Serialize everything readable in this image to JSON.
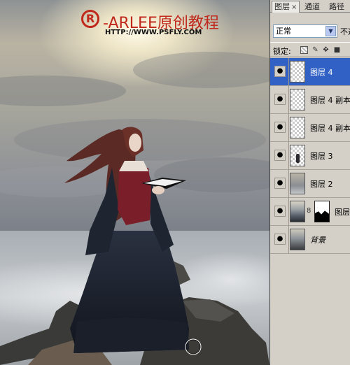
{
  "watermark": {
    "logo_mark": "R",
    "brand": "-ARLEE原创教程",
    "url": "HTTP://WWW.PSFLY.COM"
  },
  "layers_panel": {
    "tabs": [
      {
        "label": "图层",
        "active": true,
        "close": "×"
      },
      {
        "label": "通道",
        "active": false
      },
      {
        "label": "路径",
        "active": false
      }
    ],
    "blend_mode": "正常",
    "opacity_label": "不透",
    "lock_label": "锁定:",
    "lock_icons": [
      "lock-transparent-icon",
      "lock-image-icon",
      "lock-position-icon",
      "lock-all-icon"
    ],
    "layers": [
      {
        "name": "图层 4",
        "selected": true,
        "thumb": "transparent"
      },
      {
        "name": "图层 4 副本",
        "selected": false,
        "thumb": "transparent"
      },
      {
        "name": "图层 4 副本",
        "selected": false,
        "thumb": "transparent"
      },
      {
        "name": "图层 3",
        "selected": false,
        "thumb": "figure"
      },
      {
        "name": "图层 2",
        "selected": false,
        "thumb": "sky"
      },
      {
        "name": "图层",
        "selected": false,
        "thumb": "scene",
        "has_mask": true
      },
      {
        "name": "背景",
        "selected": false,
        "thumb": "background",
        "italic": true
      }
    ]
  },
  "colors": {
    "selected_layer": "#3161c5",
    "panel_bg": "#d4d0c8",
    "watermark_red": "#c0281c"
  }
}
